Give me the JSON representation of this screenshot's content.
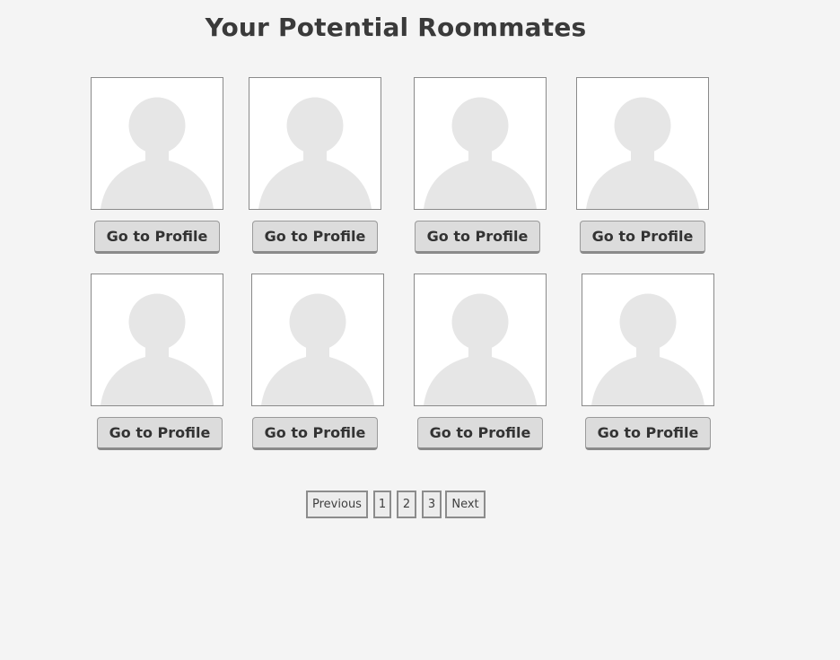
{
  "page_title": "Your Potential Roommates",
  "profiles": [
    {
      "avatar_icon": "person-silhouette-icon",
      "button_label": "Go to Profile"
    },
    {
      "avatar_icon": "person-silhouette-icon",
      "button_label": "Go to Profile"
    },
    {
      "avatar_icon": "person-silhouette-icon",
      "button_label": "Go to Profile"
    },
    {
      "avatar_icon": "person-silhouette-icon",
      "button_label": "Go to Profile"
    },
    {
      "avatar_icon": "person-silhouette-icon",
      "button_label": "Go to Profile"
    },
    {
      "avatar_icon": "person-silhouette-icon",
      "button_label": "Go to Profile"
    },
    {
      "avatar_icon": "person-silhouette-icon",
      "button_label": "Go to Profile"
    },
    {
      "avatar_icon": "person-silhouette-icon",
      "button_label": "Go to Profile"
    }
  ],
  "pagination": {
    "previous_label": "Previous",
    "pages": [
      "1",
      "2",
      "3"
    ],
    "next_label": "Next"
  },
  "colors": {
    "background": "#f4f4f4",
    "silhouette": "#e6e6e6",
    "button_fill": "#dcdcdc",
    "border": "#8a8a8a",
    "text": "#3a3a3a"
  }
}
